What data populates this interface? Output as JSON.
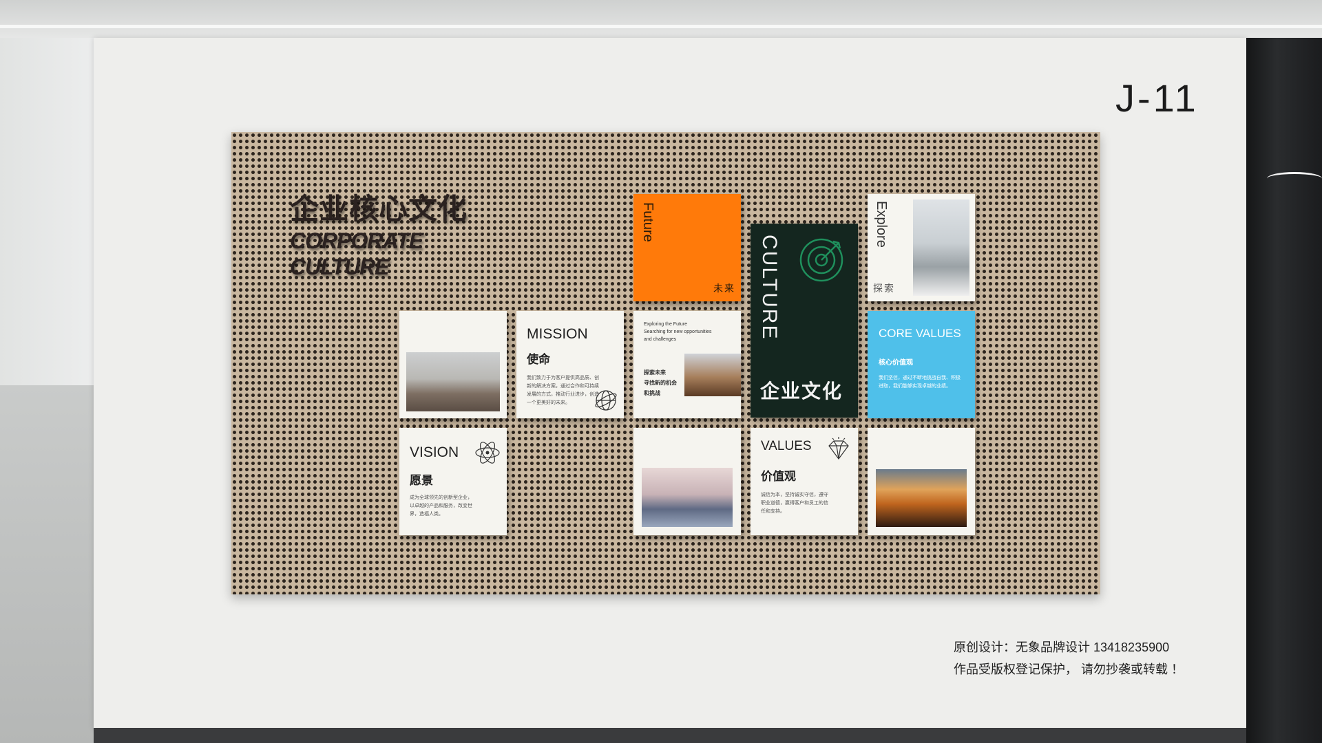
{
  "code": "J-11",
  "heading": {
    "zh": "企业核心文化",
    "en_line1": "CORPORATE",
    "en_line2": "CULTURE"
  },
  "future": {
    "en": "Future",
    "zh": "未来"
  },
  "culture": {
    "en": "CULTURE",
    "zh": "企业文化"
  },
  "explore": {
    "en": "Explore",
    "zh": "探索"
  },
  "mission": {
    "en": "MISSION",
    "zh": "使命",
    "text": "我们致力于为客户提供高品质、创新的解决方案，通过合作和可持续发展的方式，推动行业进步，创造一个更美好的未来。"
  },
  "exploring": {
    "en1": "Exploring the Future",
    "en2": "Searching for new opportunities",
    "en3": "and challenges",
    "zh1": "探索未来",
    "zh2": "寻找新的机会",
    "zh3": "和挑战"
  },
  "core_values": {
    "en": "CORE VALUES",
    "zh": "核心价值观",
    "text": "我们坚信，通过不断地挑战自我、积极进取，我们能够实现卓越的业绩。"
  },
  "vision": {
    "en": "VISION",
    "zh": "愿景",
    "text": "成为全球领先的创新型企业，以卓越的产品和服务，改变世界，造福人类。"
  },
  "values": {
    "en": "VALUES",
    "zh": "价值观",
    "text": "诚信为本，坚持诚实守信，遵守职业道德，赢得客户和员工的信任和支持。"
  },
  "credit": {
    "line1": "原创设计：无象品牌设计 13418235900",
    "line2": "作品受版权登记保护， 请勿抄袭或转载 ！"
  },
  "colors": {
    "orange": "#ff7a0a",
    "dark_green": "#14261f",
    "sky_blue": "#4fc0ea",
    "board": "#c9b79f"
  }
}
